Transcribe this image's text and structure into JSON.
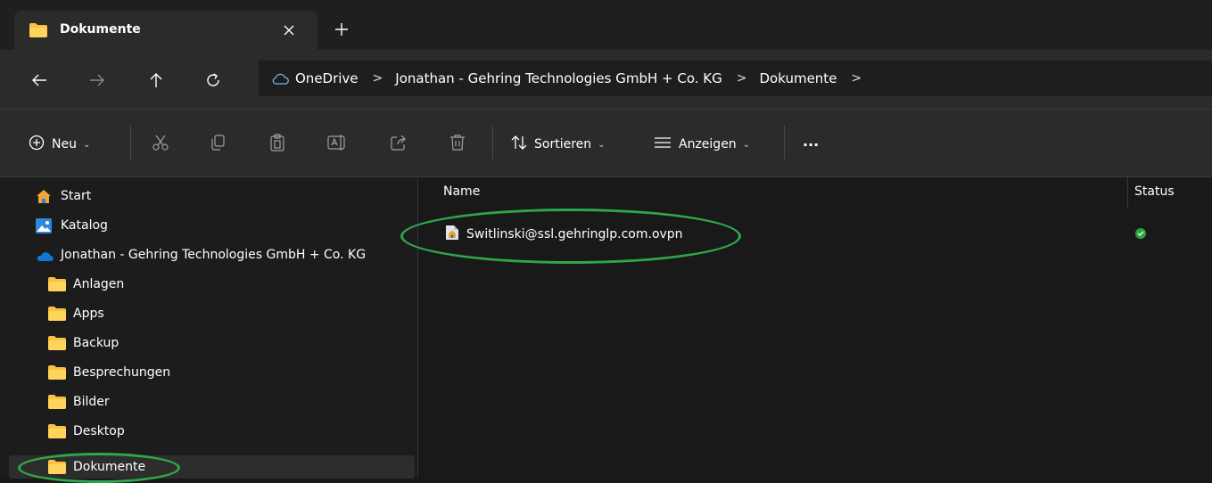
{
  "window": {
    "tab_title": "Dokumente",
    "close_symbol": "✕",
    "new_tab_symbol": "+"
  },
  "address_bar": {
    "nav": {
      "back_icon": "arrow-left-icon",
      "forward_icon": "arrow-right-icon",
      "up_icon": "arrow-up-icon",
      "refresh_icon": "refresh-icon"
    },
    "breadcrumbs": [
      "OneDrive",
      "Jonathan - Gehring Technologies GmbH + Co. KG",
      "Dokumente"
    ],
    "separator": ">"
  },
  "command_bar": {
    "new_label": "Neu",
    "sort_label": "Sortieren",
    "view_label": "Anzeigen",
    "more_label": "···"
  },
  "sidebar": {
    "items": [
      {
        "label": "Start",
        "icon": "home-icon"
      },
      {
        "label": "Katalog",
        "icon": "gallery-icon"
      },
      {
        "label": "Jonathan - Gehring Technologies GmbH + Co. KG",
        "icon": "onedrive-cloud-icon"
      },
      {
        "label": "Anlagen",
        "icon": "folder-icon"
      },
      {
        "label": "Apps",
        "icon": "folder-icon"
      },
      {
        "label": "Backup",
        "icon": "folder-icon"
      },
      {
        "label": "Besprechungen",
        "icon": "folder-icon"
      },
      {
        "label": "Bilder",
        "icon": "folder-icon"
      },
      {
        "label": "Desktop",
        "icon": "folder-icon"
      },
      {
        "label": "Dokumente",
        "icon": "folder-icon",
        "selected": true
      }
    ]
  },
  "file_list": {
    "columns": [
      "Name",
      "Status"
    ],
    "files": [
      {
        "name": "Switlinski@ssl.gehringlp.com.ovpn",
        "status": "synced",
        "icon": "ovpn-file-icon"
      }
    ]
  },
  "colors": {
    "background": "#191919",
    "toolbar": "#2b2b2b",
    "folder": "#f5c242",
    "onedrive": "#0f78d4",
    "status_ok": "#2ea043",
    "annotation": "#2fa64a"
  }
}
